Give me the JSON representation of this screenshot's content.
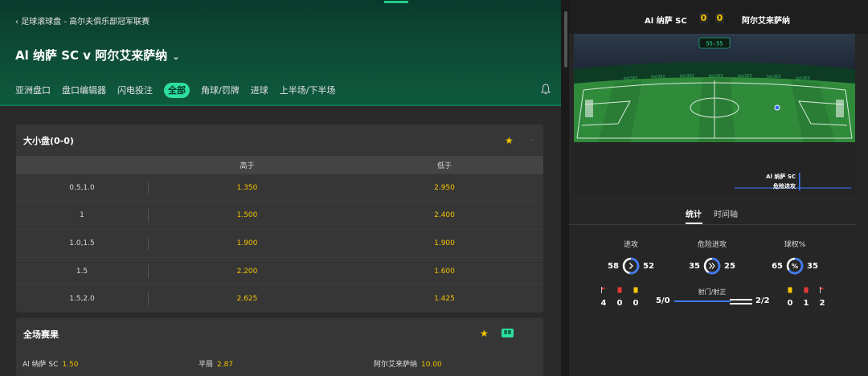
{
  "breadcrumb": "足球滚球盘 - 高尔夫俱乐部冠军联赛",
  "match_title": "Al 纳萨 SC v 阿尔艾来萨纳",
  "tabs": [
    "亚洲盘口",
    "盘口编辑器",
    "闪电投注",
    "全部",
    "角球/罚牌",
    "进球",
    "上半场/下半场"
  ],
  "active_tab": "全部",
  "market1": {
    "title": "大小盘(0-0)",
    "col_over": "高于",
    "col_under": "低于",
    "rows": [
      {
        "line": "0.5,1.0",
        "over": "1.350",
        "under": "2.950"
      },
      {
        "line": "1",
        "over": "1.500",
        "under": "2.400"
      },
      {
        "line": "1.0,1.5",
        "over": "1.900",
        "under": "1.900"
      },
      {
        "line": "1.5",
        "over": "2.200",
        "under": "1.600"
      },
      {
        "line": "1.5,2.0",
        "over": "2.625",
        "under": "1.425"
      }
    ]
  },
  "market2": {
    "title": "全场赛果",
    "badge": "88",
    "home": {
      "name": "Al 纳萨 SC",
      "odds": "1.50"
    },
    "draw": {
      "name": "平局",
      "odds": "2.87"
    },
    "away": {
      "name": "阿尔艾来萨纳",
      "odds": "10.00"
    }
  },
  "scoreboard": {
    "home": "Al 纳萨 SC",
    "away": "阿尔艾来萨纳",
    "home_score": "0",
    "away_score": "0",
    "clock": "55:55"
  },
  "pitch_overlay": {
    "team": "Al 纳萨 SC",
    "event": "危险进攻"
  },
  "stat_tabs": [
    "统计",
    "时间轴"
  ],
  "stats": [
    {
      "label": "进攻",
      "home": "58",
      "away": "52",
      "home_share": 0.53
    },
    {
      "label": "危险进攻",
      "home": "35",
      "away": "25",
      "home_share": 0.58
    },
    {
      "label": "球权%",
      "home": "65",
      "away": "35",
      "home_share": 0.65
    }
  ],
  "shots": {
    "label": "射门/射正",
    "home": "5/0",
    "away": "2/2"
  },
  "cards_home": {
    "corners": "4",
    "red": "0",
    "yellow": "0"
  },
  "cards_away": {
    "yellow": "0",
    "red": "1",
    "corners": "2"
  },
  "colors": {
    "accent": "#2de0a0",
    "odds": "#f2c200",
    "header": "#0d4a35",
    "ring": "#3b7bff"
  }
}
